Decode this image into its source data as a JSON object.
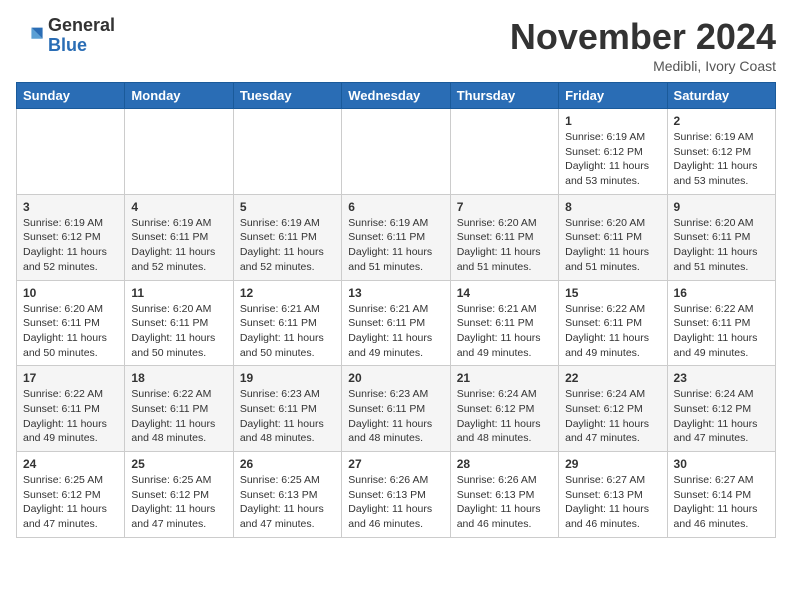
{
  "header": {
    "logo_general": "General",
    "logo_blue": "Blue",
    "month_title": "November 2024",
    "location": "Medibli, Ivory Coast"
  },
  "weekdays": [
    "Sunday",
    "Monday",
    "Tuesday",
    "Wednesday",
    "Thursday",
    "Friday",
    "Saturday"
  ],
  "weeks": [
    [
      {
        "day": "",
        "info": ""
      },
      {
        "day": "",
        "info": ""
      },
      {
        "day": "",
        "info": ""
      },
      {
        "day": "",
        "info": ""
      },
      {
        "day": "",
        "info": ""
      },
      {
        "day": "1",
        "info": "Sunrise: 6:19 AM\nSunset: 6:12 PM\nDaylight: 11 hours\nand 53 minutes."
      },
      {
        "day": "2",
        "info": "Sunrise: 6:19 AM\nSunset: 6:12 PM\nDaylight: 11 hours\nand 53 minutes."
      }
    ],
    [
      {
        "day": "3",
        "info": "Sunrise: 6:19 AM\nSunset: 6:12 PM\nDaylight: 11 hours\nand 52 minutes."
      },
      {
        "day": "4",
        "info": "Sunrise: 6:19 AM\nSunset: 6:11 PM\nDaylight: 11 hours\nand 52 minutes."
      },
      {
        "day": "5",
        "info": "Sunrise: 6:19 AM\nSunset: 6:11 PM\nDaylight: 11 hours\nand 52 minutes."
      },
      {
        "day": "6",
        "info": "Sunrise: 6:19 AM\nSunset: 6:11 PM\nDaylight: 11 hours\nand 51 minutes."
      },
      {
        "day": "7",
        "info": "Sunrise: 6:20 AM\nSunset: 6:11 PM\nDaylight: 11 hours\nand 51 minutes."
      },
      {
        "day": "8",
        "info": "Sunrise: 6:20 AM\nSunset: 6:11 PM\nDaylight: 11 hours\nand 51 minutes."
      },
      {
        "day": "9",
        "info": "Sunrise: 6:20 AM\nSunset: 6:11 PM\nDaylight: 11 hours\nand 51 minutes."
      }
    ],
    [
      {
        "day": "10",
        "info": "Sunrise: 6:20 AM\nSunset: 6:11 PM\nDaylight: 11 hours\nand 50 minutes."
      },
      {
        "day": "11",
        "info": "Sunrise: 6:20 AM\nSunset: 6:11 PM\nDaylight: 11 hours\nand 50 minutes."
      },
      {
        "day": "12",
        "info": "Sunrise: 6:21 AM\nSunset: 6:11 PM\nDaylight: 11 hours\nand 50 minutes."
      },
      {
        "day": "13",
        "info": "Sunrise: 6:21 AM\nSunset: 6:11 PM\nDaylight: 11 hours\nand 49 minutes."
      },
      {
        "day": "14",
        "info": "Sunrise: 6:21 AM\nSunset: 6:11 PM\nDaylight: 11 hours\nand 49 minutes."
      },
      {
        "day": "15",
        "info": "Sunrise: 6:22 AM\nSunset: 6:11 PM\nDaylight: 11 hours\nand 49 minutes."
      },
      {
        "day": "16",
        "info": "Sunrise: 6:22 AM\nSunset: 6:11 PM\nDaylight: 11 hours\nand 49 minutes."
      }
    ],
    [
      {
        "day": "17",
        "info": "Sunrise: 6:22 AM\nSunset: 6:11 PM\nDaylight: 11 hours\nand 49 minutes."
      },
      {
        "day": "18",
        "info": "Sunrise: 6:22 AM\nSunset: 6:11 PM\nDaylight: 11 hours\nand 48 minutes."
      },
      {
        "day": "19",
        "info": "Sunrise: 6:23 AM\nSunset: 6:11 PM\nDaylight: 11 hours\nand 48 minutes."
      },
      {
        "day": "20",
        "info": "Sunrise: 6:23 AM\nSunset: 6:11 PM\nDaylight: 11 hours\nand 48 minutes."
      },
      {
        "day": "21",
        "info": "Sunrise: 6:24 AM\nSunset: 6:12 PM\nDaylight: 11 hours\nand 48 minutes."
      },
      {
        "day": "22",
        "info": "Sunrise: 6:24 AM\nSunset: 6:12 PM\nDaylight: 11 hours\nand 47 minutes."
      },
      {
        "day": "23",
        "info": "Sunrise: 6:24 AM\nSunset: 6:12 PM\nDaylight: 11 hours\nand 47 minutes."
      }
    ],
    [
      {
        "day": "24",
        "info": "Sunrise: 6:25 AM\nSunset: 6:12 PM\nDaylight: 11 hours\nand 47 minutes."
      },
      {
        "day": "25",
        "info": "Sunrise: 6:25 AM\nSunset: 6:12 PM\nDaylight: 11 hours\nand 47 minutes."
      },
      {
        "day": "26",
        "info": "Sunrise: 6:25 AM\nSunset: 6:13 PM\nDaylight: 11 hours\nand 47 minutes."
      },
      {
        "day": "27",
        "info": "Sunrise: 6:26 AM\nSunset: 6:13 PM\nDaylight: 11 hours\nand 46 minutes."
      },
      {
        "day": "28",
        "info": "Sunrise: 6:26 AM\nSunset: 6:13 PM\nDaylight: 11 hours\nand 46 minutes."
      },
      {
        "day": "29",
        "info": "Sunrise: 6:27 AM\nSunset: 6:13 PM\nDaylight: 11 hours\nand 46 minutes."
      },
      {
        "day": "30",
        "info": "Sunrise: 6:27 AM\nSunset: 6:14 PM\nDaylight: 11 hours\nand 46 minutes."
      }
    ]
  ]
}
